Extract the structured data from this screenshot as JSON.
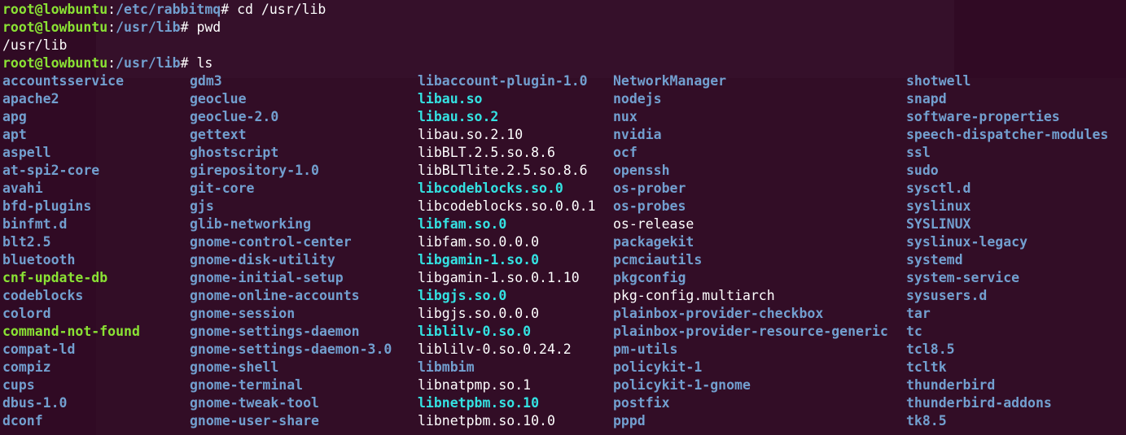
{
  "prompts": [
    {
      "user": "root@lowbuntu",
      "sep": ":",
      "path": "/etc/rabbitmq",
      "sym": "# ",
      "cmd": "cd /usr/lib"
    },
    {
      "user": "root@lowbuntu",
      "sep": ":",
      "path": "/usr/lib",
      "sym": "# ",
      "cmd": "pwd"
    },
    {
      "output": "/usr/lib"
    },
    {
      "user": "root@lowbuntu",
      "sep": ":",
      "path": "/usr/lib",
      "sym": "# ",
      "cmd": "ls"
    }
  ],
  "columns": [
    [
      {
        "name": "accountsservice",
        "type": "dir"
      },
      {
        "name": "apache2",
        "type": "dir"
      },
      {
        "name": "apg",
        "type": "dir"
      },
      {
        "name": "apt",
        "type": "dir"
      },
      {
        "name": "aspell",
        "type": "dir"
      },
      {
        "name": "at-spi2-core",
        "type": "dir"
      },
      {
        "name": "avahi",
        "type": "dir"
      },
      {
        "name": "bfd-plugins",
        "type": "dir"
      },
      {
        "name": "binfmt.d",
        "type": "dir"
      },
      {
        "name": "blt2.5",
        "type": "dir"
      },
      {
        "name": "bluetooth",
        "type": "dir"
      },
      {
        "name": "cnf-update-db",
        "type": "exec"
      },
      {
        "name": "codeblocks",
        "type": "dir"
      },
      {
        "name": "colord",
        "type": "dir"
      },
      {
        "name": "command-not-found",
        "type": "exec"
      },
      {
        "name": "compat-ld",
        "type": "dir"
      },
      {
        "name": "compiz",
        "type": "dir"
      },
      {
        "name": "cups",
        "type": "dir"
      },
      {
        "name": "dbus-1.0",
        "type": "dir"
      },
      {
        "name": "dconf",
        "type": "dir"
      }
    ],
    [
      {
        "name": "gdm3",
        "type": "dir"
      },
      {
        "name": "geoclue",
        "type": "dir"
      },
      {
        "name": "geoclue-2.0",
        "type": "dir"
      },
      {
        "name": "gettext",
        "type": "dir"
      },
      {
        "name": "ghostscript",
        "type": "dir"
      },
      {
        "name": "girepository-1.0",
        "type": "dir"
      },
      {
        "name": "git-core",
        "type": "dir"
      },
      {
        "name": "gjs",
        "type": "dir"
      },
      {
        "name": "glib-networking",
        "type": "dir"
      },
      {
        "name": "gnome-control-center",
        "type": "dir"
      },
      {
        "name": "gnome-disk-utility",
        "type": "dir"
      },
      {
        "name": "gnome-initial-setup",
        "type": "dir"
      },
      {
        "name": "gnome-online-accounts",
        "type": "dir"
      },
      {
        "name": "gnome-session",
        "type": "dir"
      },
      {
        "name": "gnome-settings-daemon",
        "type": "dir"
      },
      {
        "name": "gnome-settings-daemon-3.0",
        "type": "dir"
      },
      {
        "name": "gnome-shell",
        "type": "dir"
      },
      {
        "name": "gnome-terminal",
        "type": "dir"
      },
      {
        "name": "gnome-tweak-tool",
        "type": "dir"
      },
      {
        "name": "gnome-user-share",
        "type": "dir"
      }
    ],
    [
      {
        "name": "libaccount-plugin-1.0",
        "type": "dir"
      },
      {
        "name": "libau.so",
        "type": "link"
      },
      {
        "name": "libau.so.2",
        "type": "link"
      },
      {
        "name": "libau.so.2.10",
        "type": "file"
      },
      {
        "name": "libBLT.2.5.so.8.6",
        "type": "file"
      },
      {
        "name": "libBLTlite.2.5.so.8.6",
        "type": "file"
      },
      {
        "name": "libcodeblocks.so.0",
        "type": "link"
      },
      {
        "name": "libcodeblocks.so.0.0.1",
        "type": "file"
      },
      {
        "name": "libfam.so.0",
        "type": "link"
      },
      {
        "name": "libfam.so.0.0.0",
        "type": "file"
      },
      {
        "name": "libgamin-1.so.0",
        "type": "link"
      },
      {
        "name": "libgamin-1.so.0.1.10",
        "type": "file"
      },
      {
        "name": "libgjs.so.0",
        "type": "link"
      },
      {
        "name": "libgjs.so.0.0.0",
        "type": "file"
      },
      {
        "name": "liblilv-0.so.0",
        "type": "link"
      },
      {
        "name": "liblilv-0.so.0.24.2",
        "type": "file"
      },
      {
        "name": "libmbim",
        "type": "dir"
      },
      {
        "name": "libnatpmp.so.1",
        "type": "file"
      },
      {
        "name": "libnetpbm.so.10",
        "type": "link"
      },
      {
        "name": "libnetpbm.so.10.0",
        "type": "file"
      }
    ],
    [
      {
        "name": "NetworkManager",
        "type": "dir"
      },
      {
        "name": "nodejs",
        "type": "dir"
      },
      {
        "name": "nux",
        "type": "dir"
      },
      {
        "name": "nvidia",
        "type": "dir"
      },
      {
        "name": "ocf",
        "type": "dir"
      },
      {
        "name": "openssh",
        "type": "dir"
      },
      {
        "name": "os-prober",
        "type": "dir"
      },
      {
        "name": "os-probes",
        "type": "dir"
      },
      {
        "name": "os-release",
        "type": "file"
      },
      {
        "name": "packagekit",
        "type": "dir"
      },
      {
        "name": "pcmciautils",
        "type": "dir"
      },
      {
        "name": "pkgconfig",
        "type": "dir"
      },
      {
        "name": "pkg-config.multiarch",
        "type": "file"
      },
      {
        "name": "plainbox-provider-checkbox",
        "type": "dir"
      },
      {
        "name": "plainbox-provider-resource-generic",
        "type": "dir"
      },
      {
        "name": "pm-utils",
        "type": "dir"
      },
      {
        "name": "policykit-1",
        "type": "dir"
      },
      {
        "name": "policykit-1-gnome",
        "type": "dir"
      },
      {
        "name": "postfix",
        "type": "dir"
      },
      {
        "name": "pppd",
        "type": "dir"
      }
    ],
    [
      {
        "name": "shotwell",
        "type": "dir"
      },
      {
        "name": "snapd",
        "type": "dir"
      },
      {
        "name": "software-properties",
        "type": "dir"
      },
      {
        "name": "speech-dispatcher-modules",
        "type": "dir"
      },
      {
        "name": "ssl",
        "type": "dir"
      },
      {
        "name": "sudo",
        "type": "dir"
      },
      {
        "name": "sysctl.d",
        "type": "dir"
      },
      {
        "name": "syslinux",
        "type": "dir"
      },
      {
        "name": "SYSLINUX",
        "type": "dir"
      },
      {
        "name": "syslinux-legacy",
        "type": "dir"
      },
      {
        "name": "systemd",
        "type": "dir"
      },
      {
        "name": "system-service",
        "type": "dir"
      },
      {
        "name": "sysusers.d",
        "type": "dir"
      },
      {
        "name": "tar",
        "type": "dir"
      },
      {
        "name": "tc",
        "type": "dir"
      },
      {
        "name": "tcl8.5",
        "type": "dir"
      },
      {
        "name": "tcltk",
        "type": "dir"
      },
      {
        "name": "thunderbird",
        "type": "dir"
      },
      {
        "name": "thunderbird-addons",
        "type": "dir"
      },
      {
        "name": "tk8.5",
        "type": "dir"
      }
    ]
  ],
  "colors": {
    "background": "#300a24",
    "user": "#8ae234",
    "directory": "#729fcf",
    "symlink": "#34e2e2",
    "file": "#ffffff",
    "executable": "#8ae234"
  }
}
